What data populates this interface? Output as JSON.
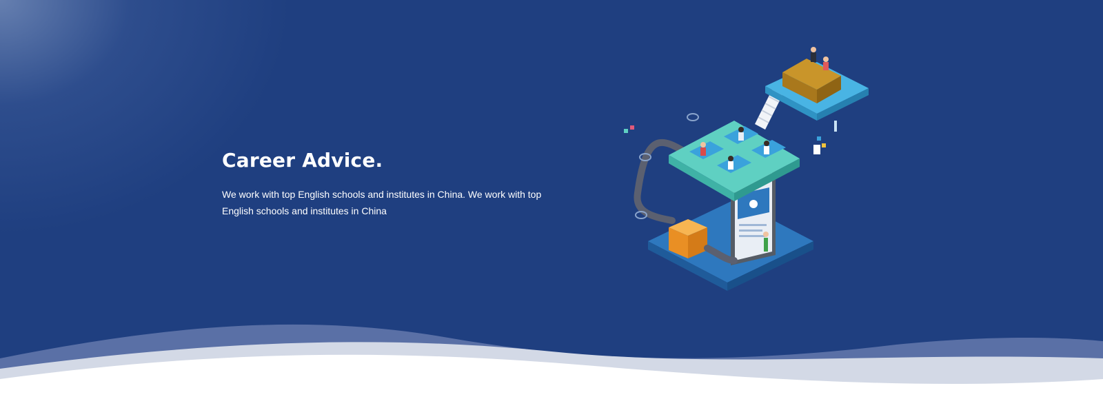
{
  "hero": {
    "title": "Career Advice.",
    "description": "We work with top English schools and institutes in China. We work with top English schools and institutes in China"
  },
  "colors": {
    "background": "#1f3f80",
    "wave_light": "#d3d9e6",
    "wave_mid": "#5a70a6",
    "accent_teal": "#5fd0c2",
    "accent_blue": "#3aa2dc",
    "accent_orange": "#f3a33b"
  },
  "illustration": {
    "icon": "isometric-education-network-illustration"
  }
}
